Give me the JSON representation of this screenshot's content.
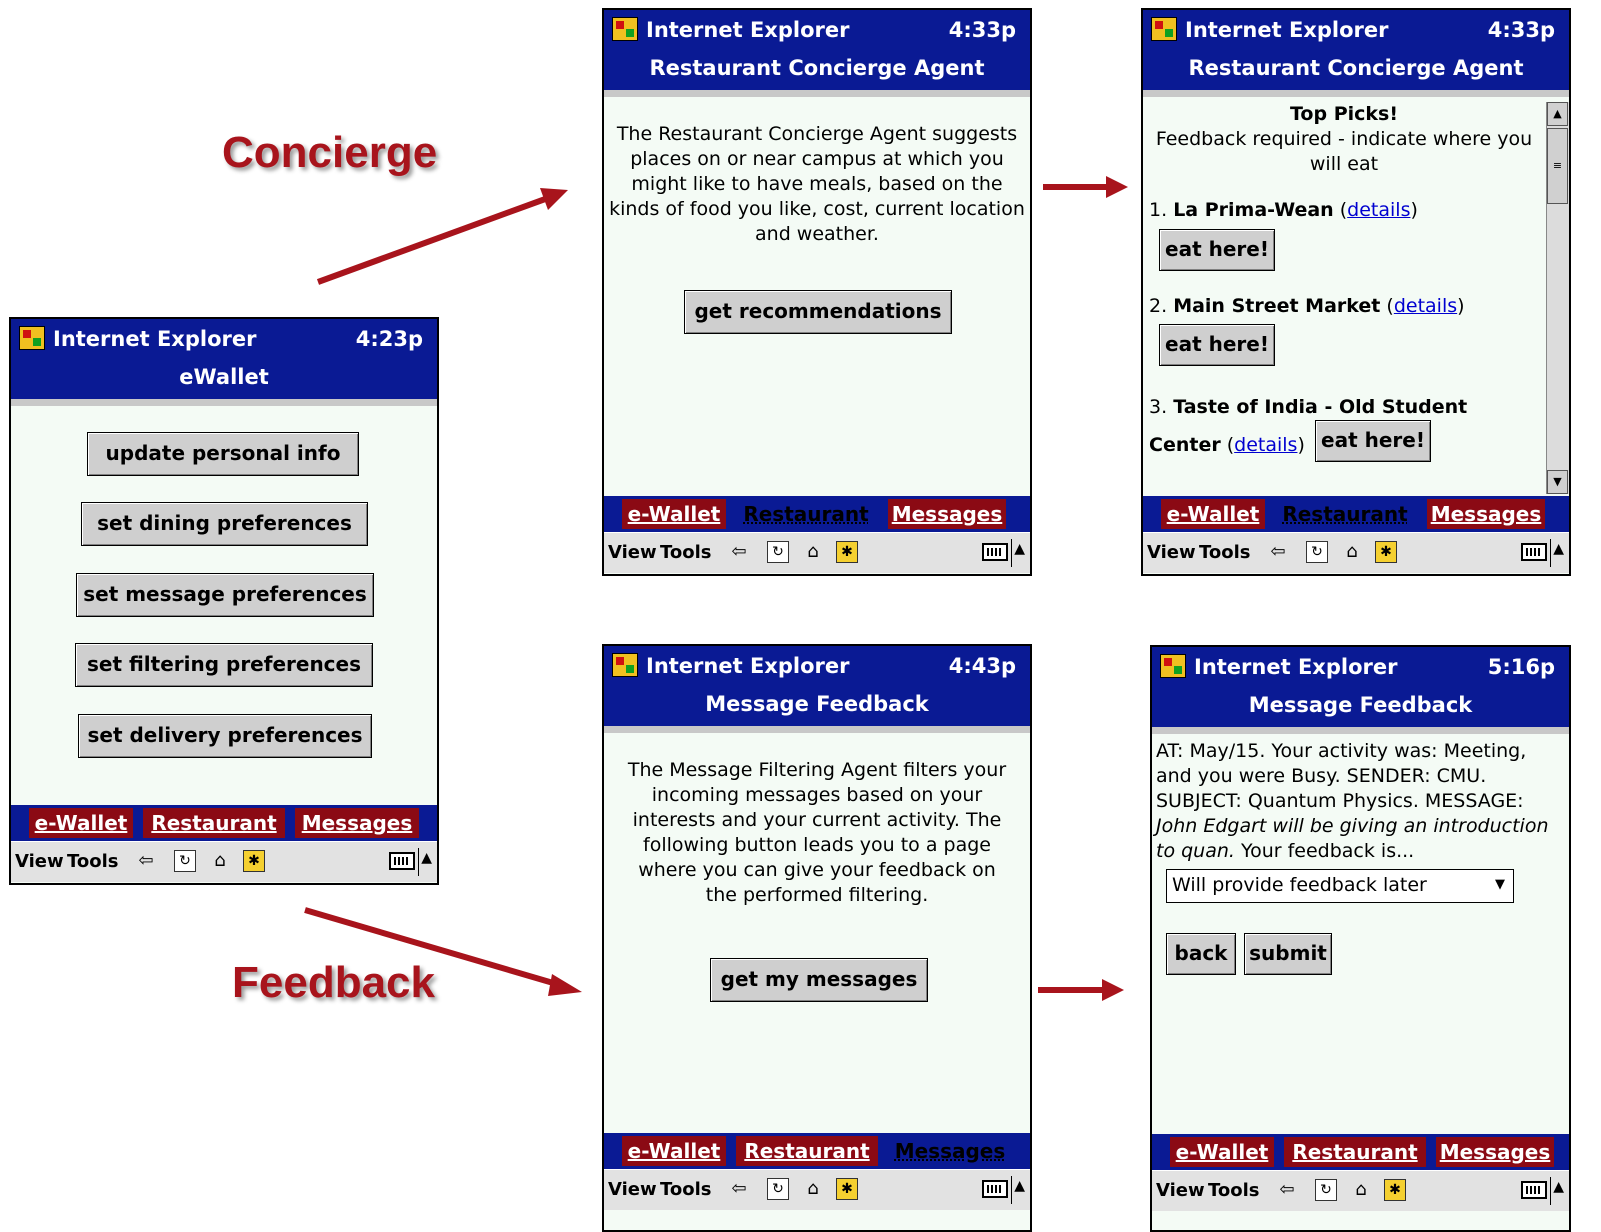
{
  "labels": {
    "concierge": "Concierge",
    "feedback": "Feedback"
  },
  "common": {
    "app_name": "Internet Explorer",
    "tabs": [
      "e-Wallet",
      "Restaurant",
      "Messages"
    ],
    "toolbar": {
      "view": "View",
      "tools": "Tools"
    }
  },
  "ewallet": {
    "clock": "4:23p",
    "page_title": "eWallet",
    "buttons": [
      "update personal info",
      "set dining preferences",
      "set message preferences",
      "set filtering preferences",
      "set delivery preferences"
    ]
  },
  "concierge_intro": {
    "clock": "4:33p",
    "page_title": "Restaurant Concierge Agent",
    "description": "The Restaurant Concierge Agent suggests places on or near campus at which you might like to have meals, based on the kinds of food you like, cost, current location and weather.",
    "button": "get recommendations"
  },
  "concierge_picks": {
    "clock": "4:33p",
    "page_title": "Restaurant Concierge Agent",
    "heading": "Top Picks!",
    "subheading": "Feedback required - indicate where you will eat",
    "details_label": "details",
    "eat_label": "eat here!",
    "picks": [
      {
        "num": "1.",
        "name": "La Prima-Wean"
      },
      {
        "num": "2.",
        "name": "Main Street Market"
      },
      {
        "num": "3.",
        "name": "Taste of India - Old Student Center"
      }
    ]
  },
  "feedback_intro": {
    "clock": "4:43p",
    "page_title": "Message Feedback",
    "description": "The Message Filtering Agent filters your incoming messages based on your interests and your current activity. The following button leads you to a page where you can give your feedback on the performed filtering.",
    "button": "get my messages"
  },
  "feedback_form": {
    "clock": "5:16p",
    "page_title": "Message Feedback",
    "message_plain": "AT: May/15. Your activity was: Meeting, and you were Busy. SENDER: CMU. SUBJECT: Quantum Physics. MESSAGE:",
    "message_italic": "John Edgart will be giving an introduction to quan.",
    "message_tail": "Your feedback is...",
    "select_value": "Will provide feedback later",
    "back_button": "back",
    "submit_button": "submit"
  },
  "colors": {
    "titlebar": "#0a1a94",
    "tab": "#8b0a14",
    "arrow": "#a8141c"
  }
}
